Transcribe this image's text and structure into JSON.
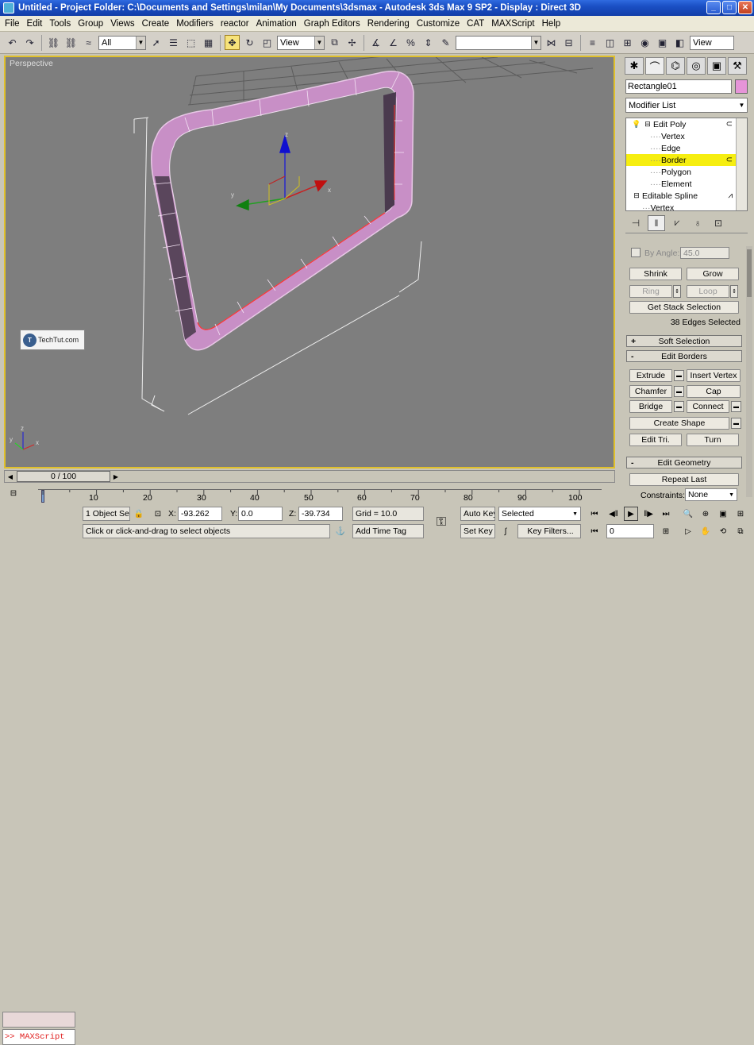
{
  "window": {
    "title": "Untitled    - Project Folder: C:\\Documents and Settings\\milan\\My Documents\\3dsmax    - Autodesk 3ds Max 9 SP2    - Display : Direct 3D",
    "controls": [
      "minimize-icon",
      "maximize-icon",
      "close-icon"
    ]
  },
  "menu": [
    "File",
    "Edit",
    "Tools",
    "Group",
    "Views",
    "Create",
    "Modifiers",
    "reactor",
    "Animation",
    "Graph Editors",
    "Rendering",
    "Customize",
    "CAT",
    "MAXScript",
    "Help"
  ],
  "toolbar": {
    "selection_filter": "All",
    "ref_coord": "View",
    "named_selection": "",
    "view_dropdown": "View"
  },
  "viewport": {
    "label": "Perspective",
    "watermark": "TechTut.com",
    "gizmo_axes": [
      "x",
      "y",
      "z"
    ],
    "corner_axes": [
      "x",
      "y",
      "z"
    ]
  },
  "command_panel": {
    "tab_icons": [
      "create-icon",
      "modify-icon",
      "hierarchy-icon",
      "motion-icon",
      "display-icon",
      "utilities-icon"
    ],
    "object_name": "Rectangle01",
    "object_color": "#e694d8",
    "modifier_list": "Modifier List",
    "stack": [
      {
        "label": "Edit Poly",
        "level": 0,
        "icon": "bulb-icon"
      },
      {
        "label": "Vertex",
        "level": 1
      },
      {
        "label": "Edge",
        "level": 1
      },
      {
        "label": "Border",
        "level": 1,
        "selected": true
      },
      {
        "label": "Polygon",
        "level": 1
      },
      {
        "label": "Element",
        "level": 1
      },
      {
        "label": "Editable Spline",
        "level": 0
      },
      {
        "label": "Vertex",
        "level": 1
      }
    ],
    "selection": {
      "by_angle_label": "By Angle:",
      "by_angle_value": "45.0",
      "shrink": "Shrink",
      "grow": "Grow",
      "ring": "Ring",
      "loop": "Loop",
      "get_stack": "Get Stack Selection",
      "status": "38 Edges Selected"
    },
    "soft_selection": {
      "sign": "+",
      "title": "Soft Selection"
    },
    "edit_borders": {
      "sign": "-",
      "title": "Edit Borders",
      "extrude": "Extrude",
      "insert_vertex": "Insert Vertex",
      "chamfer": "Chamfer",
      "cap": "Cap",
      "bridge": "Bridge",
      "connect": "Connect",
      "create_shape": "Create Shape",
      "edit_tri": "Edit Tri.",
      "turn": "Turn"
    },
    "edit_geometry": {
      "sign": "-",
      "title": "Edit Geometry",
      "repeat_last": "Repeat Last",
      "constraints_label": "Constraints:",
      "constraints_value": "None"
    }
  },
  "time": {
    "slider_label": "0 / 100",
    "ticks": [
      "0",
      "10",
      "20",
      "30",
      "40",
      "50",
      "60",
      "70",
      "80",
      "90",
      "100"
    ]
  },
  "status": {
    "selected_objects": "1 Object Se",
    "x_label": "X:",
    "x_value": "-93.262",
    "y_label": "Y:",
    "y_value": "0.0",
    "z_label": "Z:",
    "z_value": "-39.734",
    "grid": "Grid = 10.0",
    "prompt": "Click or click-and-drag to select objects",
    "add_time_tag": "Add Time Tag",
    "auto_key": "Auto Key",
    "set_key": "Set Key",
    "key_mode": "Selected",
    "key_filters": "Key Filters...",
    "frame": "0",
    "maxscript": ">> MAXScript"
  }
}
